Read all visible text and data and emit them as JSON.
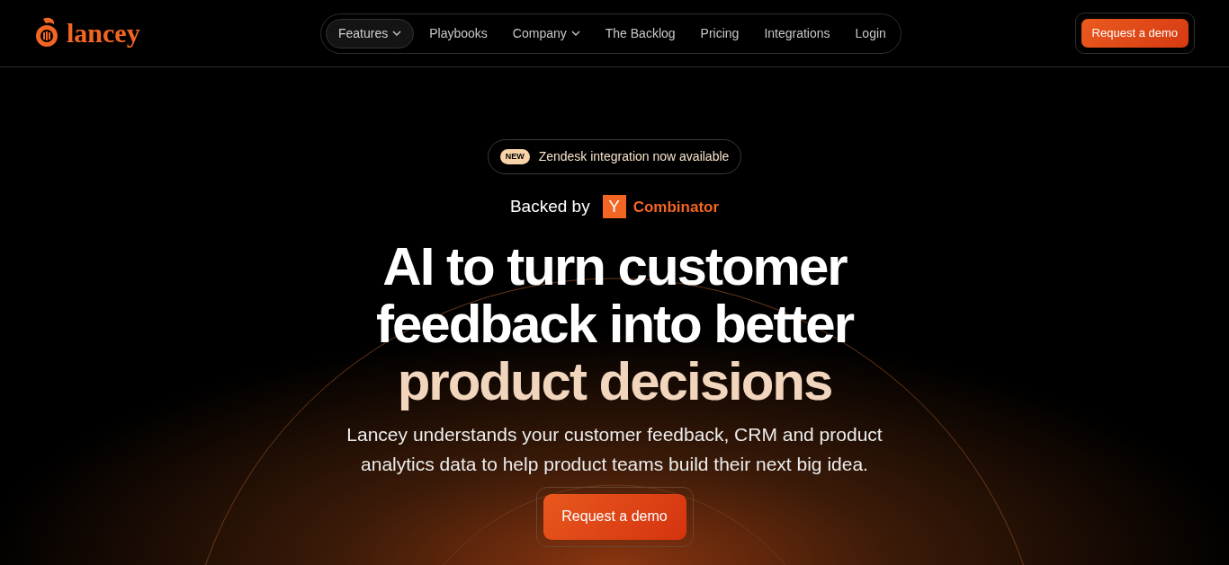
{
  "logo": {
    "text": "lancey"
  },
  "nav": [
    {
      "label": "Features",
      "has_menu": true,
      "selected": true
    },
    {
      "label": "Playbooks",
      "has_menu": false,
      "selected": false
    },
    {
      "label": "Company",
      "has_menu": true,
      "selected": false
    },
    {
      "label": "The Backlog",
      "has_menu": false,
      "selected": false
    },
    {
      "label": "Pricing",
      "has_menu": false,
      "selected": false
    },
    {
      "label": "Integrations",
      "has_menu": false,
      "selected": false
    },
    {
      "label": "Login",
      "has_menu": false,
      "selected": false
    }
  ],
  "header_button": "Request a demo",
  "announcement": {
    "badge": "NEW",
    "text": "Zendesk integration now available"
  },
  "backed_by": {
    "text": "Backed by",
    "mark": "Y",
    "name": "Combinator"
  },
  "headline": {
    "text": "AI to turn customer feedback into better",
    "accent": "product decisions"
  },
  "subtitle": "Lancey understands your customer feedback, CRM and product analytics data to help product teams build their next big idea.",
  "cta": "Request a demo"
}
